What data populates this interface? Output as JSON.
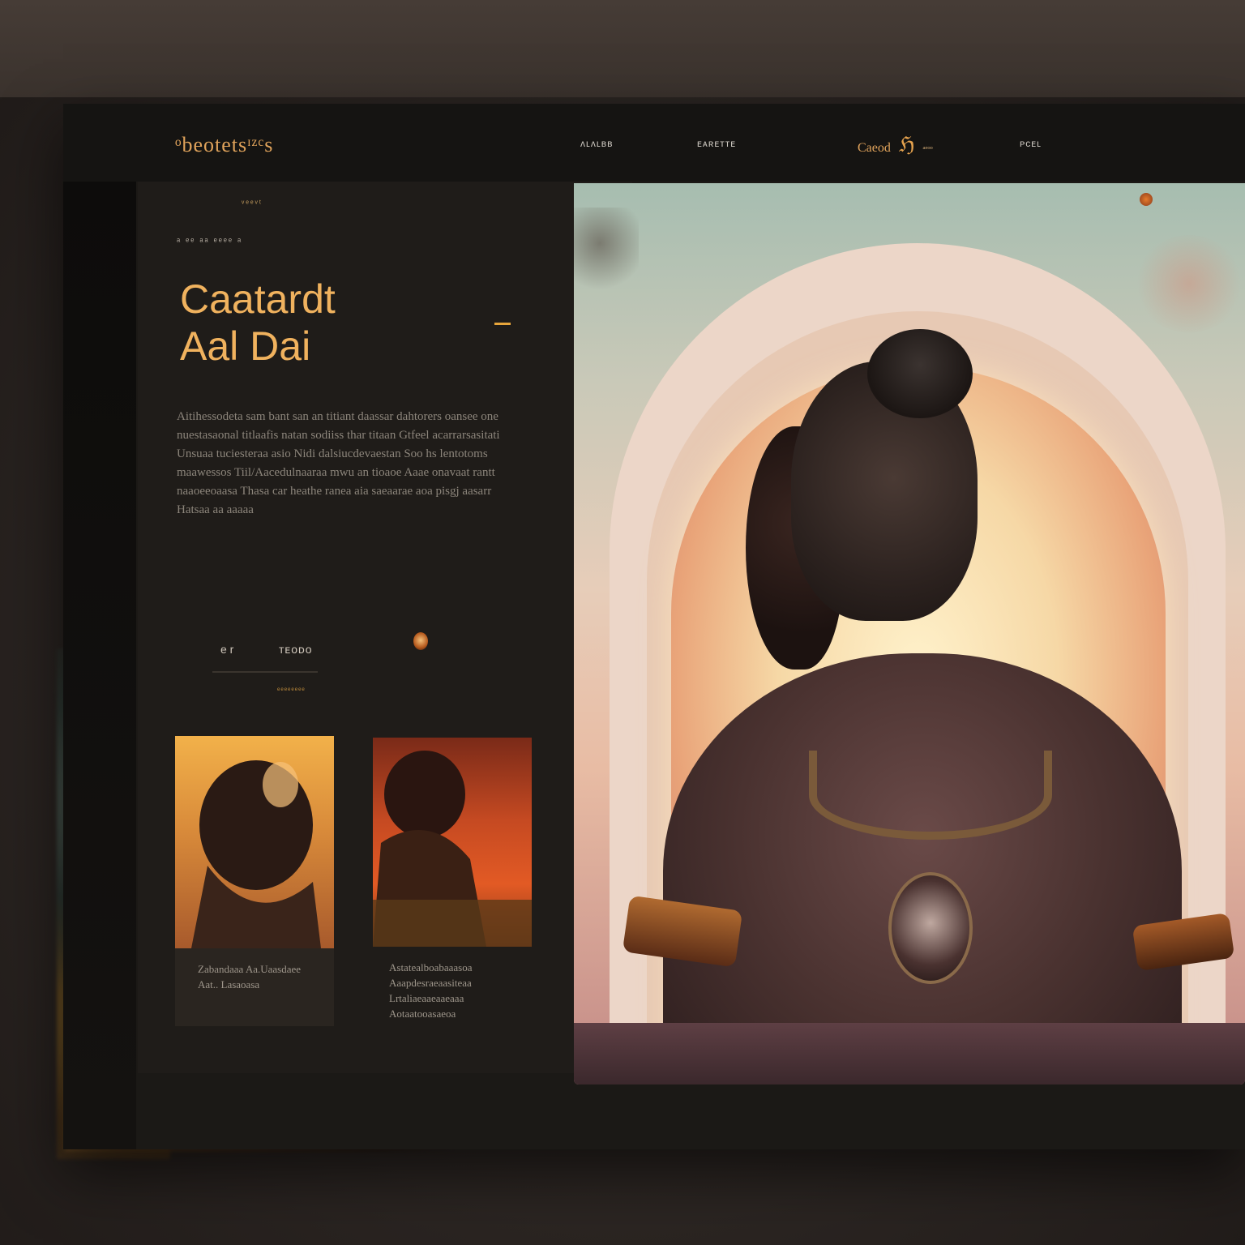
{
  "header": {
    "brand": "ᵒbeotetsᶦᶻᶜs",
    "nav": [
      "ʌʟʌʟʙʙ",
      "ᴇᴀʀᴇᴛᴛᴇ",
      "ᴘᴄᴇʟ"
    ],
    "logo": {
      "left": "Caeod",
      "glyph": "ℌ",
      "right": "ᵃᵉᵒᵒ"
    }
  },
  "hero": {
    "deco_tag": "ᵛᵉᵉᵛᵗ",
    "eyebrow": "ᵃ ᵉᵉ ᵃᵃ ᵉᵉᵉᵉ ᵃ",
    "title_line1": "Caatardt",
    "title_line2": "Aal Dai",
    "body": "Aitihessodeta sam bant san an titiant daassar dahtorers oansee one nuestasaonal titlaafis natan sodiiss thar titaan Gtfeel acarrarsasitati Unsuaa tuciesteraa asio Nidi dalsiucdevaestan Soo hs lentotoms maawessos Tiil/Aacedulnaaraa mwu an tioaoe Aaae onavaat rantt naaoeeoaasa Thasa car heathe ranea aia saeaarae aoa pisgj aasarr Hatsaa aa aaaaa",
    "meta_a": "e   r",
    "meta_b": "ᴛᴇᴏᴅᴏ",
    "cta": "ᵉᵉᵉᵉᵉᵉᵉᵉ"
  },
  "cards": [
    {
      "caption": "Zabandaaa Aa.Uaasdaee Aat.. Lasaoasa"
    },
    {
      "caption": "Astatealboabaaasoa Aaapdesraeaasiteaa Lrtaliaeaaeaaeaaa Aotaatooasaeoa"
    }
  ],
  "colors": {
    "accent": "#f0b25e",
    "panel": "#1f1c19",
    "topbar": "#151412"
  }
}
